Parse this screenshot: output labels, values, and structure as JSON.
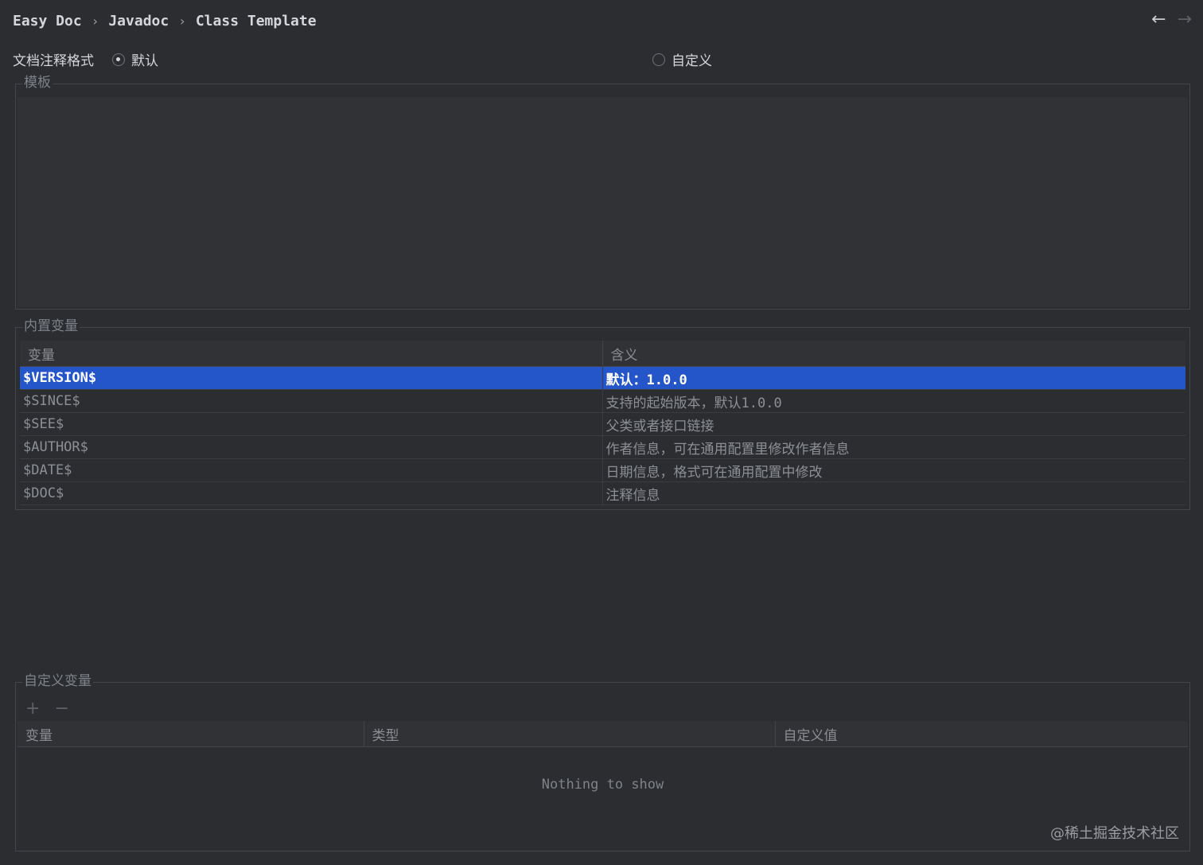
{
  "breadcrumb": [
    "Easy Doc",
    "Javadoc",
    "Class Template"
  ],
  "nav": {
    "back_icon": "←",
    "forward_icon": "→"
  },
  "format": {
    "label": "文档注释格式",
    "options": [
      {
        "label": "默认",
        "selected": true
      },
      {
        "label": "自定义",
        "selected": false
      }
    ]
  },
  "template_group": {
    "title": "模板"
  },
  "builtin_group": {
    "title": "内置变量",
    "columns": [
      "变量",
      "含义"
    ],
    "rows": [
      {
        "var": "$VERSION$",
        "meaning": "默认：1.0.0",
        "selected": true
      },
      {
        "var": "$SINCE$",
        "meaning": "支持的起始版本，默认1.0.0"
      },
      {
        "var": "$SEE$",
        "meaning": "父类或者接口链接"
      },
      {
        "var": "$AUTHOR$",
        "meaning": "作者信息，可在通用配置里修改作者信息"
      },
      {
        "var": "$DATE$",
        "meaning": "日期信息，格式可在通用配置中修改"
      },
      {
        "var": "$DOC$",
        "meaning": "注释信息"
      }
    ]
  },
  "custom_group": {
    "title": "自定义变量",
    "add_icon": "+",
    "remove_icon": "−",
    "columns": [
      "变量",
      "类型",
      "自定义值"
    ],
    "empty_text": "Nothing to show"
  },
  "watermark": "@稀土掘金技术社区"
}
